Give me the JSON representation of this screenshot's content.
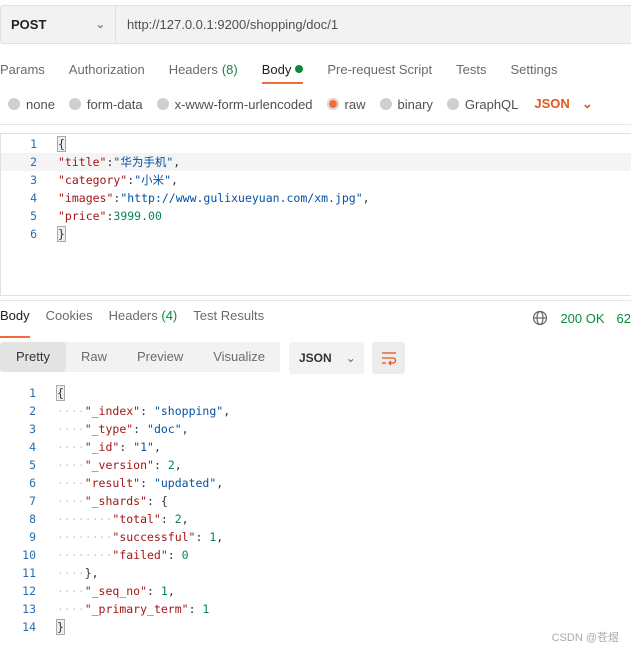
{
  "request": {
    "method": "POST",
    "url": "http://127.0.0.1:9200/shopping/doc/1"
  },
  "tabs": [
    {
      "label": "Params"
    },
    {
      "label": "Authorization"
    },
    {
      "label": "Headers",
      "count": "(8)"
    },
    {
      "label": "Body",
      "active": true
    },
    {
      "label": "Pre-request Script"
    },
    {
      "label": "Tests"
    },
    {
      "label": "Settings"
    }
  ],
  "body_types": [
    {
      "label": "none"
    },
    {
      "label": "form-data"
    },
    {
      "label": "x-www-form-urlencoded"
    },
    {
      "label": "raw",
      "selected": true
    },
    {
      "label": "binary"
    },
    {
      "label": "GraphQL"
    }
  ],
  "body_format": "JSON",
  "request_body": [
    [
      [
        "p",
        "{"
      ]
    ],
    [
      [
        "k",
        "\"title\""
      ],
      [
        "p",
        ":"
      ],
      [
        "s",
        "\"华为手机\""
      ],
      [
        "p",
        ","
      ]
    ],
    [
      [
        "k",
        "\"category\""
      ],
      [
        "p",
        ":"
      ],
      [
        "s",
        "\"小米\""
      ],
      [
        "p",
        ","
      ]
    ],
    [
      [
        "k",
        "\"images\""
      ],
      [
        "p",
        ":"
      ],
      [
        "s",
        "\"http://www.gulixueyuan.com/xm.jpg\""
      ],
      [
        "p",
        ","
      ]
    ],
    [
      [
        "k",
        "\"price\""
      ],
      [
        "p",
        ":"
      ],
      [
        "n",
        "3999.00"
      ]
    ],
    [
      [
        "p",
        "}"
      ]
    ]
  ],
  "response_tabs": [
    {
      "label": "Body",
      "active": true
    },
    {
      "label": "Cookies"
    },
    {
      "label": "Headers",
      "count": "(4)"
    },
    {
      "label": "Test Results"
    }
  ],
  "status": {
    "code": "200 OK",
    "time": "62"
  },
  "view_modes": [
    "Pretty",
    "Raw",
    "Preview",
    "Visualize"
  ],
  "response_format": "JSON",
  "response_body": [
    [
      [
        "p",
        "{"
      ]
    ],
    [
      [
        "ws",
        "····"
      ],
      [
        "k",
        "\"_index\""
      ],
      [
        "p",
        ": "
      ],
      [
        "s",
        "\"shopping\""
      ],
      [
        "p",
        ","
      ]
    ],
    [
      [
        "ws",
        "····"
      ],
      [
        "k",
        "\"_type\""
      ],
      [
        "p",
        ": "
      ],
      [
        "s",
        "\"doc\""
      ],
      [
        "p",
        ","
      ]
    ],
    [
      [
        "ws",
        "····"
      ],
      [
        "k",
        "\"_id\""
      ],
      [
        "p",
        ": "
      ],
      [
        "s",
        "\"1\""
      ],
      [
        "p",
        ","
      ]
    ],
    [
      [
        "ws",
        "····"
      ],
      [
        "k",
        "\"_version\""
      ],
      [
        "p",
        ": "
      ],
      [
        "n",
        "2"
      ],
      [
        "p",
        ","
      ]
    ],
    [
      [
        "ws",
        "····"
      ],
      [
        "k",
        "\"result\""
      ],
      [
        "p",
        ": "
      ],
      [
        "s",
        "\"updated\""
      ],
      [
        "p",
        ","
      ]
    ],
    [
      [
        "ws",
        "····"
      ],
      [
        "k",
        "\"_shards\""
      ],
      [
        "p",
        ": {"
      ]
    ],
    [
      [
        "ws",
        "········"
      ],
      [
        "k",
        "\"total\""
      ],
      [
        "p",
        ": "
      ],
      [
        "n",
        "2"
      ],
      [
        "p",
        ","
      ]
    ],
    [
      [
        "ws",
        "········"
      ],
      [
        "k",
        "\"successful\""
      ],
      [
        "p",
        ": "
      ],
      [
        "n",
        "1"
      ],
      [
        "p",
        ","
      ]
    ],
    [
      [
        "ws",
        "········"
      ],
      [
        "k",
        "\"failed\""
      ],
      [
        "p",
        ": "
      ],
      [
        "n",
        "0"
      ]
    ],
    [
      [
        "ws",
        "····"
      ],
      [
        "p",
        "},"
      ]
    ],
    [
      [
        "ws",
        "····"
      ],
      [
        "k",
        "\"_seq_no\""
      ],
      [
        "p",
        ": "
      ],
      [
        "n",
        "1"
      ],
      [
        "p",
        ","
      ]
    ],
    [
      [
        "ws",
        "····"
      ],
      [
        "k",
        "\"_primary_term\""
      ],
      [
        "p",
        ": "
      ],
      [
        "n",
        "1"
      ]
    ],
    [
      [
        "p",
        "}"
      ]
    ]
  ],
  "watermark": "CSDN @苍煜"
}
